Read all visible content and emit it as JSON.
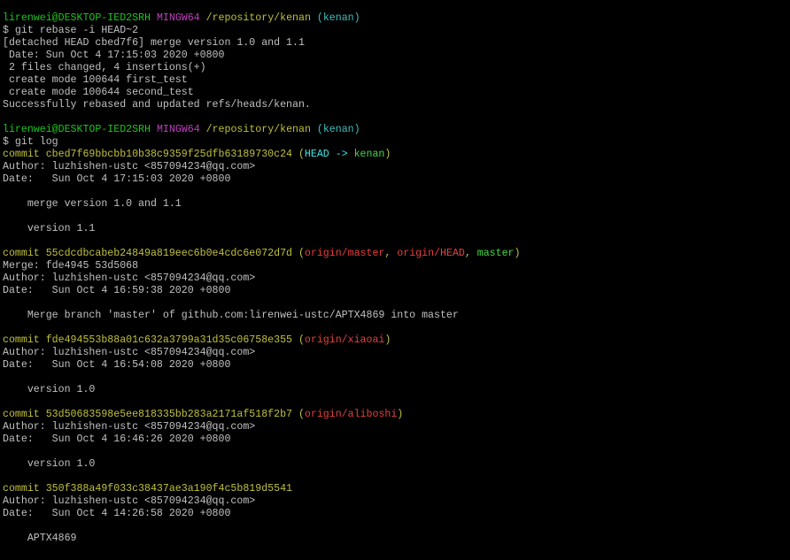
{
  "window": {
    "background": "#000000",
    "default_text_color": "#c0c0c0"
  },
  "colors": {
    "prompt_user": "#1ec51e",
    "prompt_env": "#bf3fbf",
    "prompt_path": "#c0c03c",
    "prompt_branch": "#3fbfbf",
    "commit": "#c0c03c",
    "head_ref": "#3fe6e6",
    "local_branch": "#3fdd3f",
    "remote_branch": "#e63f3f",
    "text": "#c0c0c0"
  },
  "lines": [
    {
      "name": "prompt-line",
      "segments": [
        {
          "text": "lirenwei@DESKTOP-IED2SRH",
          "color": "#1ec51e"
        },
        {
          "text": " ",
          "color": "#c0c0c0"
        },
        {
          "text": "MINGW64",
          "color": "#bf3fbf"
        },
        {
          "text": " ",
          "color": "#c0c0c0"
        },
        {
          "text": "/repository/kenan",
          "color": "#c0c03c"
        },
        {
          "text": " ",
          "color": "#c0c0c0"
        },
        {
          "text": "(kenan)",
          "color": "#3fbfbf"
        }
      ]
    },
    {
      "name": "command-line",
      "segments": [
        {
          "text": "$ git rebase -i HEAD~2",
          "color": "#c0c0c0"
        }
      ]
    },
    {
      "name": "output-line",
      "segments": [
        {
          "text": "[detached HEAD cbed7f6] merge version 1.0 and 1.1",
          "color": "#c0c0c0"
        }
      ]
    },
    {
      "name": "output-line",
      "segments": [
        {
          "text": " Date: Sun Oct 4 17:15:03 2020 +0800",
          "color": "#c0c0c0"
        }
      ]
    },
    {
      "name": "output-line",
      "segments": [
        {
          "text": " 2 files changed, 4 insertions(+)",
          "color": "#c0c0c0"
        }
      ]
    },
    {
      "name": "output-line",
      "segments": [
        {
          "text": " create mode 100644 first_test",
          "color": "#c0c0c0"
        }
      ]
    },
    {
      "name": "output-line",
      "segments": [
        {
          "text": " create mode 100644 second_test",
          "color": "#c0c0c0"
        }
      ]
    },
    {
      "name": "output-line",
      "segments": [
        {
          "text": "Successfully rebased and updated refs/heads/kenan.",
          "color": "#c0c0c0"
        }
      ]
    },
    {
      "name": "blank-line",
      "segments": []
    },
    {
      "name": "prompt-line",
      "segments": [
        {
          "text": "lirenwei@DESKTOP-IED2SRH",
          "color": "#1ec51e"
        },
        {
          "text": " ",
          "color": "#c0c0c0"
        },
        {
          "text": "MINGW64",
          "color": "#bf3fbf"
        },
        {
          "text": " ",
          "color": "#c0c0c0"
        },
        {
          "text": "/repository/kenan",
          "color": "#c0c03c"
        },
        {
          "text": " ",
          "color": "#c0c0c0"
        },
        {
          "text": "(kenan)",
          "color": "#3fbfbf"
        }
      ]
    },
    {
      "name": "command-line",
      "segments": [
        {
          "text": "$ git log",
          "color": "#c0c0c0"
        }
      ]
    },
    {
      "name": "commit-line",
      "segments": [
        {
          "text": "commit cbed7f69bbcbb10b38c9359f25dfb63189730c24",
          "color": "#c0c03c"
        },
        {
          "text": " (",
          "color": "#c0c03c"
        },
        {
          "text": "HEAD -> ",
          "color": "#3fe6e6"
        },
        {
          "text": "kenan",
          "color": "#3fdd3f"
        },
        {
          "text": ")",
          "color": "#c0c03c"
        }
      ]
    },
    {
      "name": "author-line",
      "segments": [
        {
          "text": "Author: luzhishen-ustc <857094234@qq.com>",
          "color": "#c0c0c0"
        }
      ]
    },
    {
      "name": "date-line",
      "segments": [
        {
          "text": "Date:   Sun Oct 4 17:15:03 2020 +0800",
          "color": "#c0c0c0"
        }
      ]
    },
    {
      "name": "blank-line",
      "segments": []
    },
    {
      "name": "message-line",
      "segments": [
        {
          "text": "    merge version 1.0 and 1.1",
          "color": "#c0c0c0"
        }
      ]
    },
    {
      "name": "blank-line",
      "segments": []
    },
    {
      "name": "message-line",
      "segments": [
        {
          "text": "    version 1.1",
          "color": "#c0c0c0"
        }
      ]
    },
    {
      "name": "blank-line",
      "segments": []
    },
    {
      "name": "commit-line",
      "segments": [
        {
          "text": "commit 55cdcdbcabeb24849a819eec6b0e4cdc6e072d7d",
          "color": "#c0c03c"
        },
        {
          "text": " (",
          "color": "#c0c03c"
        },
        {
          "text": "origin/master",
          "color": "#e63f3f"
        },
        {
          "text": ", ",
          "color": "#c0c03c"
        },
        {
          "text": "origin/HEAD",
          "color": "#e63f3f"
        },
        {
          "text": ", ",
          "color": "#c0c03c"
        },
        {
          "text": "master",
          "color": "#3fdd3f"
        },
        {
          "text": ")",
          "color": "#c0c03c"
        }
      ]
    },
    {
      "name": "merge-line",
      "segments": [
        {
          "text": "Merge: fde4945 53d5068",
          "color": "#c0c0c0"
        }
      ]
    },
    {
      "name": "author-line",
      "segments": [
        {
          "text": "Author: luzhishen-ustc <857094234@qq.com>",
          "color": "#c0c0c0"
        }
      ]
    },
    {
      "name": "date-line",
      "segments": [
        {
          "text": "Date:   Sun Oct 4 16:59:38 2020 +0800",
          "color": "#c0c0c0"
        }
      ]
    },
    {
      "name": "blank-line",
      "segments": []
    },
    {
      "name": "message-line",
      "segments": [
        {
          "text": "    Merge branch 'master' of github.com:lirenwei-ustc/APTX4869 into master",
          "color": "#c0c0c0"
        }
      ]
    },
    {
      "name": "blank-line",
      "segments": []
    },
    {
      "name": "commit-line",
      "segments": [
        {
          "text": "commit fde494553b88a01c632a3799a31d35c06758e355",
          "color": "#c0c03c"
        },
        {
          "text": " (",
          "color": "#c0c03c"
        },
        {
          "text": "origin/xiaoai",
          "color": "#e63f3f"
        },
        {
          "text": ")",
          "color": "#c0c03c"
        }
      ]
    },
    {
      "name": "author-line",
      "segments": [
        {
          "text": "Author: luzhishen-ustc <857094234@qq.com>",
          "color": "#c0c0c0"
        }
      ]
    },
    {
      "name": "date-line",
      "segments": [
        {
          "text": "Date:   Sun Oct 4 16:54:08 2020 +0800",
          "color": "#c0c0c0"
        }
      ]
    },
    {
      "name": "blank-line",
      "segments": []
    },
    {
      "name": "message-line",
      "segments": [
        {
          "text": "    version 1.0",
          "color": "#c0c0c0"
        }
      ]
    },
    {
      "name": "blank-line",
      "segments": []
    },
    {
      "name": "commit-line",
      "segments": [
        {
          "text": "commit 53d50683598e5ee818335bb283a2171af518f2b7",
          "color": "#c0c03c"
        },
        {
          "text": " (",
          "color": "#c0c03c"
        },
        {
          "text": "origin/aliboshi",
          "color": "#e63f3f"
        },
        {
          "text": ")",
          "color": "#c0c03c"
        }
      ]
    },
    {
      "name": "author-line",
      "segments": [
        {
          "text": "Author: luzhishen-ustc <857094234@qq.com>",
          "color": "#c0c0c0"
        }
      ]
    },
    {
      "name": "date-line",
      "segments": [
        {
          "text": "Date:   Sun Oct 4 16:46:26 2020 +0800",
          "color": "#c0c0c0"
        }
      ]
    },
    {
      "name": "blank-line",
      "segments": []
    },
    {
      "name": "message-line",
      "segments": [
        {
          "text": "    version 1.0",
          "color": "#c0c0c0"
        }
      ]
    },
    {
      "name": "blank-line",
      "segments": []
    },
    {
      "name": "commit-line",
      "segments": [
        {
          "text": "commit 350f388a49f033c38437ae3a190f4c5b819d5541",
          "color": "#c0c03c"
        }
      ]
    },
    {
      "name": "author-line",
      "segments": [
        {
          "text": "Author: luzhishen-ustc <857094234@qq.com>",
          "color": "#c0c0c0"
        }
      ]
    },
    {
      "name": "date-line",
      "segments": [
        {
          "text": "Date:   Sun Oct 4 14:26:58 2020 +0800",
          "color": "#c0c0c0"
        }
      ]
    },
    {
      "name": "blank-line",
      "segments": []
    },
    {
      "name": "message-line",
      "segments": [
        {
          "text": "    APTX4869",
          "color": "#c0c0c0"
        }
      ]
    }
  ]
}
